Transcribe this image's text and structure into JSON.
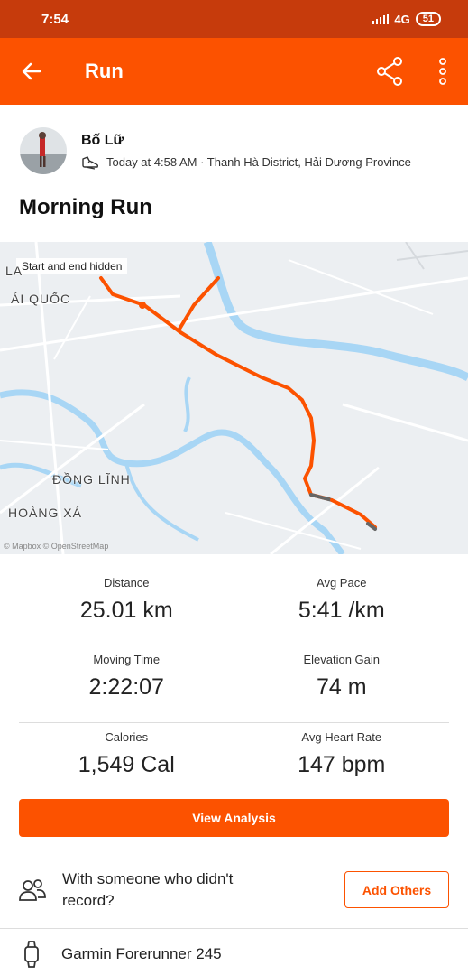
{
  "status": {
    "time": "7:54",
    "network": "4G",
    "battery": "51"
  },
  "header": {
    "title": "Run"
  },
  "athlete": {
    "name": "Bố Lữ",
    "meta": "Today at 4:58 AM · Thanh Hà District, Hải Dương Province"
  },
  "activity": {
    "title": "Morning Run"
  },
  "map": {
    "notice": "Start and end hidden",
    "places": [
      "ÁI QUỐC",
      "ĐỒNG LĨNH",
      "HOÀNG XÁ",
      "LA"
    ],
    "attribution": "© Mapbox © OpenStreetMap",
    "route_color": "#fc5200"
  },
  "stats": [
    {
      "label": "Distance",
      "value": "25.01 km"
    },
    {
      "label": "Avg Pace",
      "value": "5:41 /km"
    },
    {
      "label": "Moving Time",
      "value": "2:22:07"
    },
    {
      "label": "Elevation Gain",
      "value": "74 m"
    },
    {
      "label": "Calories",
      "value": "1,549 Cal"
    },
    {
      "label": "Avg Heart Rate",
      "value": "147 bpm"
    }
  ],
  "actions": {
    "view_analysis": "View Analysis",
    "with_others_text": "With someone who didn't record?",
    "add_others": "Add Others"
  },
  "device": {
    "name": "Garmin Forerunner 245"
  },
  "colors": {
    "accent": "#fc5200",
    "status_bar": "#c63b0c"
  },
  "icons": [
    "back-arrow-icon",
    "share-icon",
    "more-vertical-icon",
    "shoe-icon",
    "people-icon",
    "watch-icon"
  ]
}
